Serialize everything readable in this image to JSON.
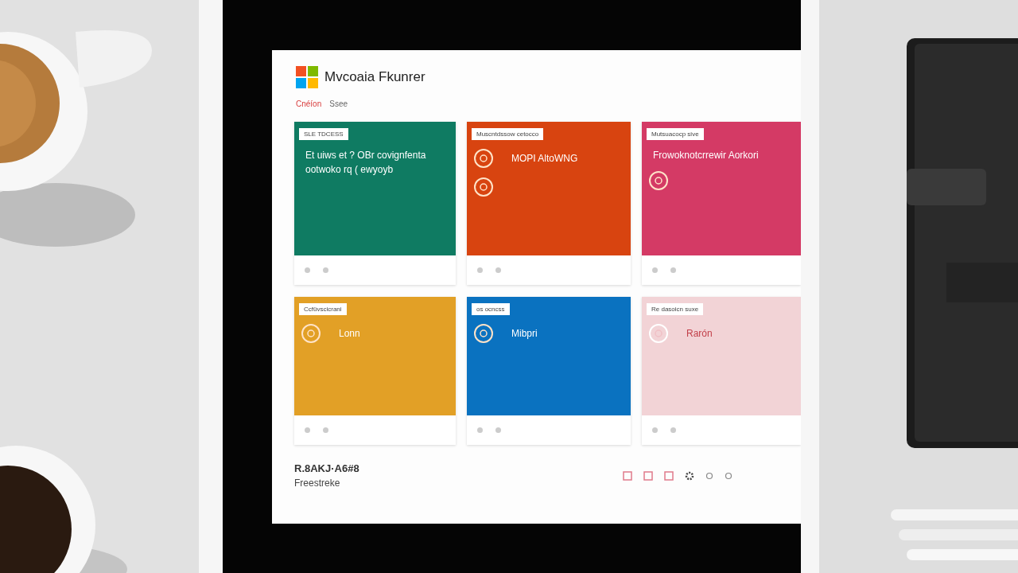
{
  "app": {
    "title": "Mvcoaia Fkunrer"
  },
  "tabs": [
    {
      "label": "Cnéíon",
      "selected": true
    },
    {
      "label": "Ssee",
      "selected": false
    }
  ],
  "cards": [
    {
      "tag": "SLE TDCESS",
      "title": "Et uiws et ? OBr covignfenta ootwoko rq ( ewyoyb",
      "kind": "plain",
      "color": "#0f7b62",
      "light": false
    },
    {
      "tag": "Muscntdssow cetocco",
      "title": "MOPI AltoWNG",
      "kind": "double-icon",
      "color": "#d84410",
      "light": false
    },
    {
      "tag": "Mutsuacocp sive",
      "title": "Frowoknotcrrewir Aorkori",
      "kind": "title-icon",
      "color": "#d43a65",
      "light": false
    },
    {
      "tag": "Ccfüvscicrani",
      "title": "Lonn",
      "kind": "icon",
      "color": "#e2a026",
      "light": false
    },
    {
      "tag": "os ocncss",
      "title": "Mibpri",
      "kind": "icon",
      "color": "#0a72c0",
      "light": false
    },
    {
      "tag": "Re dasoicn suxe",
      "title": "Rarón",
      "kind": "icon",
      "color": "#f2d3d6",
      "light": true
    }
  ],
  "footer": {
    "name": "R.8AKJ·A6#8",
    "subtitle": "Freestreke"
  }
}
